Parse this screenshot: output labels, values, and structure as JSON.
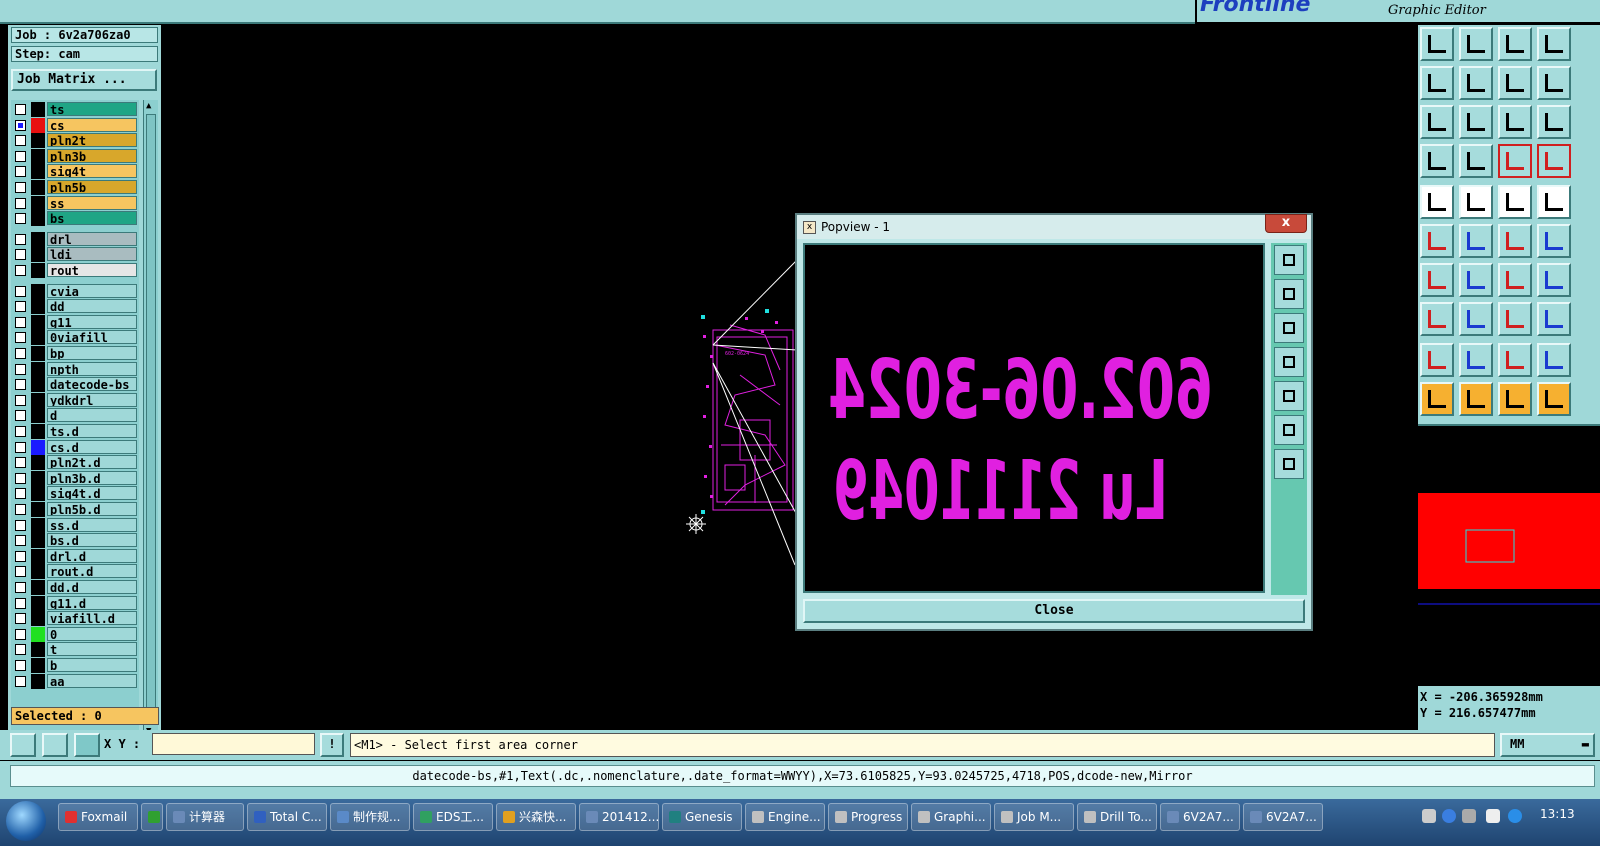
{
  "app": {
    "brand": "Frontline",
    "subtitle": "Graphic Editor"
  },
  "job_panel": {
    "job_line": "Job : 6v2a706za0",
    "step_line": "Step: cam",
    "job_matrix_button": "Job Matrix ...",
    "layers": [
      {
        "name": "ts",
        "color": "#1fa585",
        "swatch": "#000",
        "checked": false
      },
      {
        "name": "cs",
        "color": "#f6c560",
        "swatch": "#e81010",
        "checked": true
      },
      {
        "name": "pln2t",
        "color": "#d8a72b",
        "swatch": "#000",
        "checked": false
      },
      {
        "name": "pln3b",
        "color": "#d8a72b",
        "swatch": "#000",
        "checked": false
      },
      {
        "name": "sig4t",
        "color": "#f6c560",
        "swatch": "#000",
        "checked": false
      },
      {
        "name": "pln5b",
        "color": "#d8a72b",
        "swatch": "#000",
        "checked": false
      },
      {
        "name": "ss",
        "color": "#f6c560",
        "swatch": "#000",
        "checked": false
      },
      {
        "name": "bs",
        "color": "#1fa585",
        "swatch": "#000",
        "checked": false
      },
      {
        "name": "drl",
        "color": "#a9bcc0",
        "swatch": "#000",
        "checked": false
      },
      {
        "name": "ldi",
        "color": "#a9bcc0",
        "swatch": "#000",
        "checked": false
      },
      {
        "name": "rout",
        "color": "#e6e6e6",
        "swatch": "#000",
        "checked": false
      },
      {
        "name": "cvia",
        "color": "#9fd8d8",
        "swatch": "#000",
        "checked": false
      },
      {
        "name": "dd",
        "color": "#9fd8d8",
        "swatch": "#000",
        "checked": false
      },
      {
        "name": "g11",
        "color": "#9fd8d8",
        "swatch": "#000",
        "checked": false
      },
      {
        "name": "0viafill",
        "color": "#9fd8d8",
        "swatch": "#000",
        "checked": false
      },
      {
        "name": "bp",
        "color": "#9fd8d8",
        "swatch": "#000",
        "checked": false
      },
      {
        "name": "npth",
        "color": "#9fd8d8",
        "swatch": "#000",
        "checked": false
      },
      {
        "name": "datecode-bs",
        "color": "#9fd8d8",
        "swatch": "#000",
        "checked": false
      },
      {
        "name": "ydkdrl",
        "color": "#9fd8d8",
        "swatch": "#000",
        "checked": false
      },
      {
        "name": "d",
        "color": "#9fd8d8",
        "swatch": "#000",
        "checked": false
      },
      {
        "name": "ts.d",
        "color": "#9fd8d8",
        "swatch": "#000",
        "checked": false
      },
      {
        "name": "cs.d",
        "color": "#9fd8d8",
        "swatch": "#1a1aff",
        "checked": false
      },
      {
        "name": "pln2t.d",
        "color": "#9fd8d8",
        "swatch": "#000",
        "checked": false
      },
      {
        "name": "pln3b.d",
        "color": "#9fd8d8",
        "swatch": "#000",
        "checked": false
      },
      {
        "name": "sig4t.d",
        "color": "#9fd8d8",
        "swatch": "#000",
        "checked": false
      },
      {
        "name": "pln5b.d",
        "color": "#9fd8d8",
        "swatch": "#000",
        "checked": false
      },
      {
        "name": "ss.d",
        "color": "#9fd8d8",
        "swatch": "#000",
        "checked": false
      },
      {
        "name": "bs.d",
        "color": "#9fd8d8",
        "swatch": "#000",
        "checked": false
      },
      {
        "name": "drl.d",
        "color": "#9fd8d8",
        "swatch": "#000",
        "checked": false
      },
      {
        "name": "rout.d",
        "color": "#9fd8d8",
        "swatch": "#000",
        "checked": false
      },
      {
        "name": "dd.d",
        "color": "#9fd8d8",
        "swatch": "#000",
        "checked": false
      },
      {
        "name": "g11.d",
        "color": "#9fd8d8",
        "swatch": "#000",
        "checked": false
      },
      {
        "name": "viafill.d",
        "color": "#9fd8d8",
        "swatch": "#000",
        "checked": false
      },
      {
        "name": "0",
        "color": "#9fd8d8",
        "swatch": "#20e020",
        "checked": false
      },
      {
        "name": "t",
        "color": "#9fd8d8",
        "swatch": "#000",
        "checked": false
      },
      {
        "name": "b",
        "color": "#9fd8d8",
        "swatch": "#000",
        "checked": false
      },
      {
        "name": "aa",
        "color": "#9fd8d8",
        "swatch": "#000",
        "checked": false
      }
    ],
    "selected": "Selected : 0"
  },
  "popview": {
    "title": "Popview - 1",
    "close_x": "x",
    "line1": "602.06-3024",
    "line2": "Lu 2111049",
    "close_button": "Close"
  },
  "coords": {
    "x_line": "X = -206.365928mm",
    "y_line": "Y = 216.657477mm"
  },
  "command_bar": {
    "xy_label": "X Y :",
    "xy_value": "",
    "excl": "!",
    "prompt": "<M1> - Select first area corner",
    "units": "MM"
  },
  "info_bar": {
    "text": "datecode-bs,#1,Text(.dc,.nomenclature,.date_format=WWYY),X=73.6105825,Y=93.0245725,4718,POS,dcode-new,Mirror"
  },
  "taskbar": {
    "tasks": [
      {
        "label": "Foxmail",
        "color": "#e03030"
      },
      {
        "label": "",
        "color": "#30a030"
      },
      {
        "label": "计算器",
        "color": "#6a8ab8"
      },
      {
        "label": "Total C...",
        "color": "#3060c0"
      },
      {
        "label": "制作规...",
        "color": "#5a8ac8"
      },
      {
        "label": "EDS工...",
        "color": "#30a060"
      },
      {
        "label": "兴森快...",
        "color": "#e0a020"
      },
      {
        "label": "201412...",
        "color": "#6a8ab8"
      },
      {
        "label": "Genesis",
        "color": "#208080"
      },
      {
        "label": "Engine...",
        "color": "#c0c0c0"
      },
      {
        "label": "Progress",
        "color": "#c0c0c0"
      },
      {
        "label": "Graphi...",
        "color": "#c0c0c0"
      },
      {
        "label": "Job M...",
        "color": "#c0c0c0"
      },
      {
        "label": "Drill To...",
        "color": "#c0c0c0"
      },
      {
        "label": "6V2A7...",
        "color": "#6a8ab8"
      },
      {
        "label": "6V2A7...",
        "color": "#6a8ab8"
      }
    ],
    "time": "13:13"
  },
  "colors": {
    "panel": "#9fd8d8",
    "magenta": "#e020e0",
    "cyan_pads": "#20e0e0",
    "overview_board": "#ff0000"
  }
}
